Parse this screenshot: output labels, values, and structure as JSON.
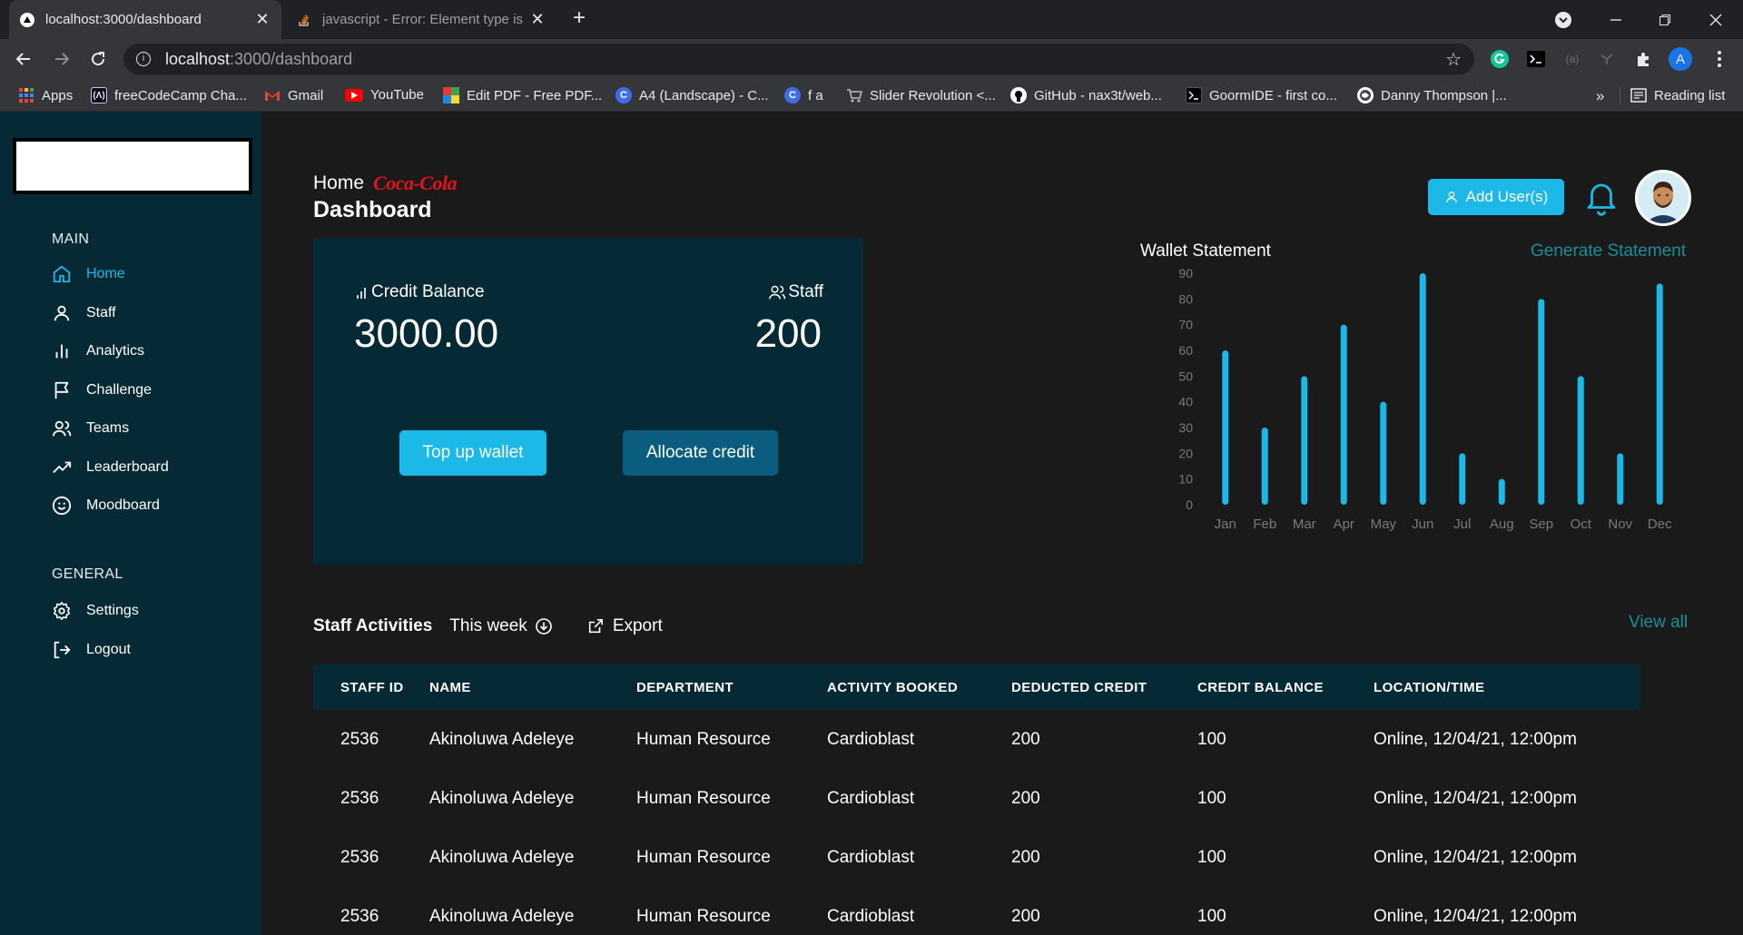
{
  "browser": {
    "tabs": [
      {
        "title": "localhost:3000/dashboard",
        "close": "✕"
      },
      {
        "title": "javascript - Error: Element type is",
        "close": "✕"
      }
    ],
    "new_tab": "+",
    "url_host": "localhost",
    "url_rest": ":3000/dashboard",
    "profile_initial": "A",
    "bookmarks": [
      {
        "label": "Apps"
      },
      {
        "label": "freeCodeCamp Cha..."
      },
      {
        "label": "Gmail"
      },
      {
        "label": "YouTube"
      },
      {
        "label": "Edit PDF - Free PDF..."
      },
      {
        "label": "A4 (Landscape) - C..."
      },
      {
        "label": "f a"
      },
      {
        "label": "Slider Revolution <..."
      },
      {
        "label": "GitHub - nax3t/web..."
      },
      {
        "label": "GoormIDE - first co..."
      },
      {
        "label": "Danny Thompson |..."
      },
      {
        "label": "»"
      },
      {
        "label": "Reading list"
      }
    ]
  },
  "sidebar": {
    "main_title": "MAIN",
    "main_items": [
      {
        "label": "Home",
        "icon": "home-icon",
        "active": true
      },
      {
        "label": "Staff",
        "icon": "user-icon"
      },
      {
        "label": "Analytics",
        "icon": "bar-chart-icon"
      },
      {
        "label": "Challenge",
        "icon": "flag-icon"
      },
      {
        "label": "Teams",
        "icon": "users-icon"
      },
      {
        "label": "Leaderboard",
        "icon": "trending-up-icon"
      },
      {
        "label": "Moodboard",
        "icon": "smile-icon"
      }
    ],
    "general_title": "GENERAL",
    "general_items": [
      {
        "label": "Settings",
        "icon": "gear-icon"
      },
      {
        "label": "Logout",
        "icon": "logout-icon"
      }
    ]
  },
  "header": {
    "breadcrumb": "Home",
    "brand": "Coca-Cola",
    "title": "Dashboard",
    "add_user_label": "Add User(s)"
  },
  "balance_card": {
    "credit_label": "Credit Balance",
    "credit_value": "3000.00",
    "staff_label": "Staff",
    "staff_value": "200",
    "top_up_label": "Top up wallet",
    "allocate_label": "Allocate credit"
  },
  "wallet": {
    "title": "Wallet Statement",
    "generate_label": "Generate Statement"
  },
  "chart_data": {
    "type": "bar",
    "title": "Wallet Statement",
    "categories": [
      "Jan",
      "Feb",
      "Mar",
      "Apr",
      "May",
      "Jun",
      "Jul",
      "Aug",
      "Sep",
      "Oct",
      "Nov",
      "Dec"
    ],
    "values": [
      60,
      30,
      50,
      70,
      40,
      90,
      20,
      10,
      80,
      50,
      20,
      86
    ],
    "ylim": [
      0,
      90
    ],
    "yticks": [
      0,
      10,
      20,
      30,
      40,
      50,
      60,
      70,
      80,
      90
    ],
    "color": "#1cb8e8",
    "grid": false
  },
  "activities": {
    "title": "Staff Activities",
    "period": "This week",
    "export_label": "Export",
    "view_all": "View all",
    "columns": [
      "STAFF ID",
      "NAME",
      "DEPARTMENT",
      "ACTIVITY BOOKED",
      "DEDUCTED CREDIT",
      "CREDIT BALANCE",
      "LOCATION/TIME"
    ],
    "rows": [
      [
        "2536",
        "Akinoluwa Adeleye",
        "Human Resource",
        "Cardioblast",
        "200",
        "100",
        "Online, 12/04/21, 12:00pm"
      ],
      [
        "2536",
        "Akinoluwa Adeleye",
        "Human Resource",
        "Cardioblast",
        "200",
        "100",
        "Online, 12/04/21, 12:00pm"
      ],
      [
        "2536",
        "Akinoluwa Adeleye",
        "Human Resource",
        "Cardioblast",
        "200",
        "100",
        "Online, 12/04/21, 12:00pm"
      ],
      [
        "2536",
        "Akinoluwa Adeleye",
        "Human Resource",
        "Cardioblast",
        "200",
        "100",
        "Online, 12/04/21, 12:00pm"
      ]
    ]
  }
}
